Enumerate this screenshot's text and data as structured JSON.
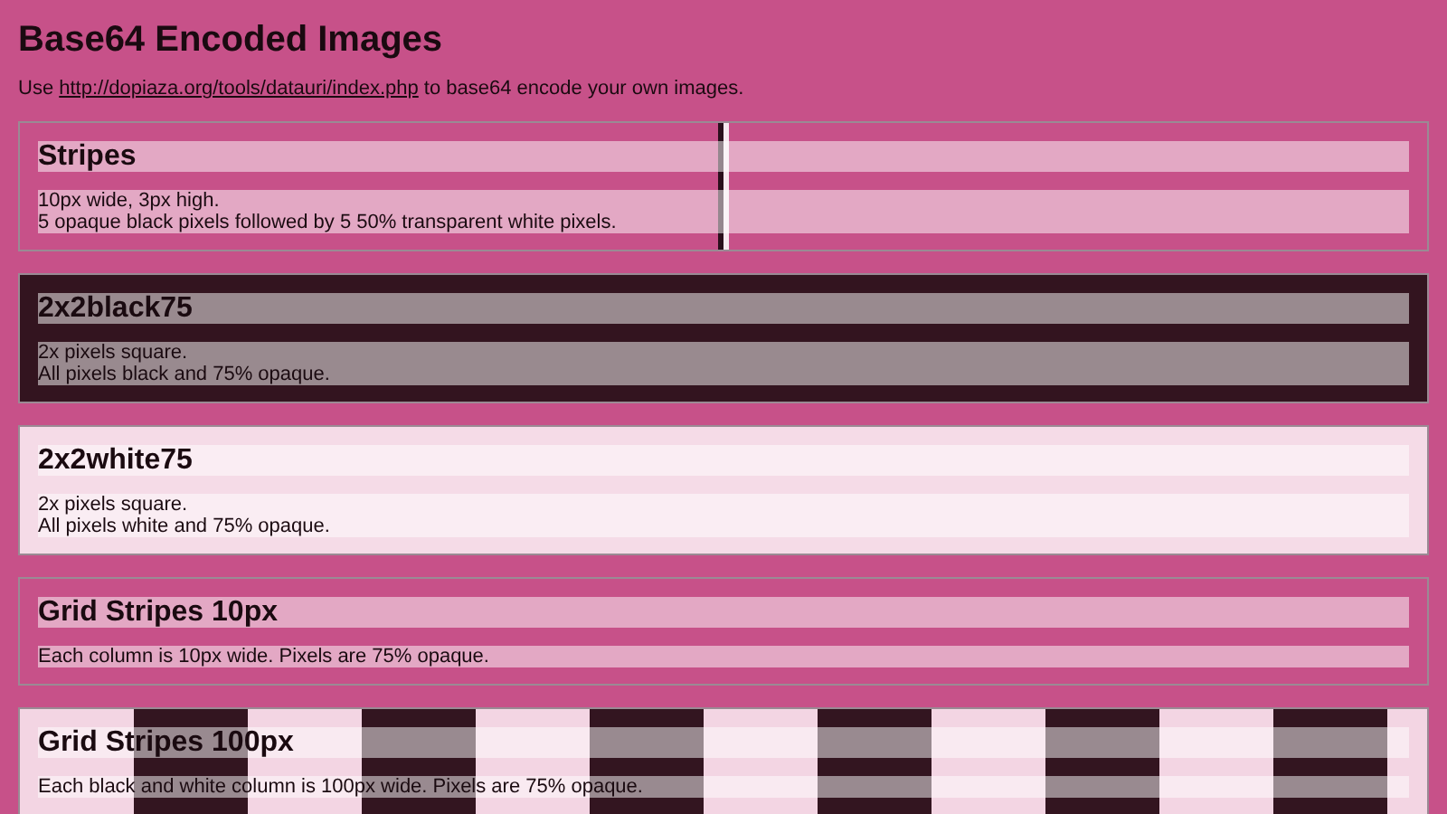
{
  "title": "Base64 Encoded Images",
  "intro": {
    "before": "Use ",
    "link": "http://dopiaza.org/tools/datauri/index.php",
    "after": " to base64 encode your own images."
  },
  "sections": [
    {
      "kind": "stripes",
      "heading": "Stripes",
      "description": [
        "10px wide, 3px high.",
        "5 opaque black pixels followed by 5 50% transparent white pixels."
      ]
    },
    {
      "kind": "black",
      "heading": "2x2black75",
      "description": [
        "2x pixels square.",
        "All pixels black and 75% opaque."
      ]
    },
    {
      "kind": "white",
      "heading": "2x2white75",
      "description": [
        "2x pixels square.",
        "All pixels white and 75% opaque."
      ]
    },
    {
      "kind": "grid10",
      "heading": "Grid Stripes 10px",
      "description": [
        "Each column is 10px wide. Pixels are 75% opaque."
      ]
    },
    {
      "kind": "grid100",
      "heading": "Grid Stripes 100px",
      "description": [
        "Each black and white column is 100px wide. Pixels are 75% opaque."
      ]
    }
  ]
}
